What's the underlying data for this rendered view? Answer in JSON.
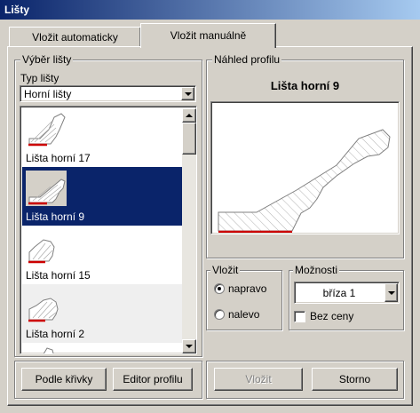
{
  "window": {
    "title": "Lišty"
  },
  "tabs": [
    {
      "label": "Vložit automaticky",
      "active": false
    },
    {
      "label": "Vložit manuálně",
      "active": true
    }
  ],
  "selection": {
    "group_label": "Výběr lišty",
    "type_label": "Typ lišty",
    "type_value": "Horní lišty",
    "items": [
      {
        "label": "Lišta horní 17",
        "selected": false
      },
      {
        "label": "Lišta horní 9",
        "selected": true
      },
      {
        "label": "Lišta horní 15",
        "selected": false
      },
      {
        "label": "Lišta horní 2",
        "selected": false
      }
    ]
  },
  "preview": {
    "group_label": "Náhled profilu",
    "title": "Lišta horní 9"
  },
  "insert": {
    "group_label": "Vložit",
    "options": [
      {
        "label": "napravo",
        "checked": true
      },
      {
        "label": "nalevo",
        "checked": false
      }
    ]
  },
  "options": {
    "group_label": "Možnosti",
    "material_value": "bříza 1",
    "no_price_label": "Bez ceny",
    "no_price_checked": false
  },
  "buttons": {
    "curve": "Podle křivky",
    "profile_editor": "Editor profilu",
    "insert": "Vložit",
    "cancel": "Storno"
  },
  "colors": {
    "selection": "#0a246a",
    "profile_base": "#cc0000"
  }
}
